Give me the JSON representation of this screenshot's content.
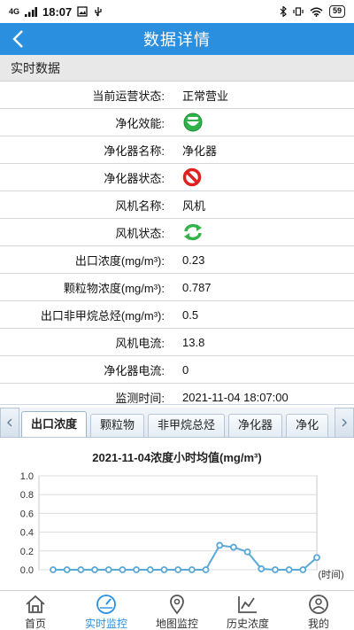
{
  "status_bar": {
    "signal": "4G",
    "time": "18:07",
    "battery": "59"
  },
  "header": {
    "title": "数据详情"
  },
  "section": {
    "title": "实时数据"
  },
  "info_rows": [
    {
      "label": "当前运营状态:",
      "value": "正常营业"
    },
    {
      "label": "净化效能:",
      "icon": "green-smiley-icon"
    },
    {
      "label": "净化器名称:",
      "value": "净化器"
    },
    {
      "label": "净化器状态:",
      "icon": "red-prohibited-icon"
    },
    {
      "label": "风机名称:",
      "value": "风机"
    },
    {
      "label": "风机状态:",
      "icon": "green-refresh-icon"
    },
    {
      "label": "出口浓度(mg/m³):",
      "value": "0.23"
    },
    {
      "label": "颗粒物浓度(mg/m³):",
      "value": "0.787"
    },
    {
      "label": "出口非甲烷总烃(mg/m³):",
      "value": "0.5"
    },
    {
      "label": "风机电流:",
      "value": "13.8"
    },
    {
      "label": "净化器电流:",
      "value": "0"
    },
    {
      "label": "监测时间:",
      "value": "2021-11-04 18:07:00"
    }
  ],
  "tabs": [
    "出口浓度",
    "颗粒物",
    "非甲烷总烃",
    "净化器",
    "净化"
  ],
  "active_tab": 0,
  "chart_data": {
    "type": "line",
    "title": "2021-11-04浓度小时均值(mg/m³)",
    "xlabel": "(时间)",
    "ylabel": "",
    "ylim": [
      0,
      1.0
    ],
    "yticks": [
      "0.0",
      "0.2",
      "0.4",
      "0.6",
      "0.8",
      "1.0"
    ],
    "series": [
      {
        "values": [
          0,
          0,
          0,
          0,
          0,
          0,
          0,
          0,
          0,
          0,
          0,
          0,
          0.26,
          0.24,
          0.19,
          0.01,
          0,
          0,
          0,
          0.13
        ]
      }
    ],
    "color": "#5aa8d8",
    "grid": true
  },
  "bottom_nav": [
    {
      "label": "首页",
      "icon": "home-icon"
    },
    {
      "label": "实时监控",
      "icon": "gauge-icon"
    },
    {
      "label": "地图监控",
      "icon": "map-pin-icon"
    },
    {
      "label": "历史浓度",
      "icon": "trend-chart-icon"
    },
    {
      "label": "我的",
      "icon": "profile-icon"
    }
  ],
  "active_nav": 1,
  "colors": {
    "accent": "#2b8fe0"
  }
}
